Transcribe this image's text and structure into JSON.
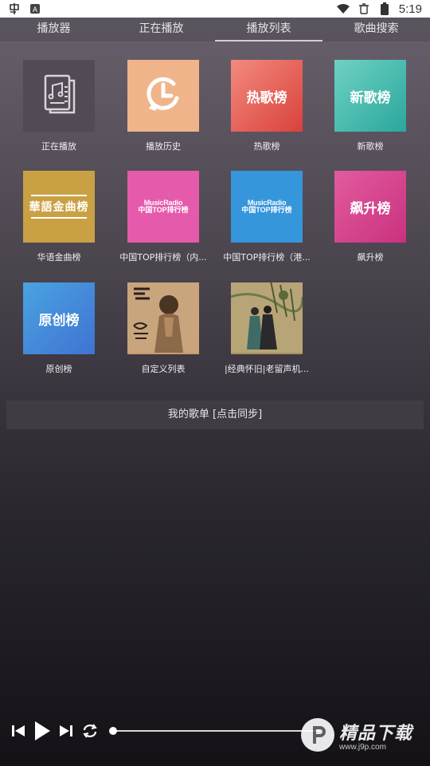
{
  "status_bar": {
    "time": "5:19",
    "icons": [
      "app-icon",
      "a-icon",
      "wifi-icon",
      "trash-icon",
      "battery-icon"
    ]
  },
  "tabs": [
    {
      "label": "播放器",
      "active": false
    },
    {
      "label": "正在播放",
      "active": false
    },
    {
      "label": "播放列表",
      "active": true
    },
    {
      "label": "歌曲搜索",
      "active": false
    }
  ],
  "playlists": [
    {
      "label": "正在播放",
      "tile_icon": "music-document-icon",
      "tile_text": ""
    },
    {
      "label": "播放历史",
      "tile_icon": "history-clock-icon",
      "tile_text": ""
    },
    {
      "label": "热歌榜",
      "tile_icon": "",
      "tile_text": "热歌榜"
    },
    {
      "label": "新歌榜",
      "tile_icon": "",
      "tile_text": "新歌榜"
    },
    {
      "label": "华语金曲榜",
      "tile_icon": "",
      "tile_text": "華語金曲榜"
    },
    {
      "label": "中国TOP排行榜（内...",
      "tile_icon": "",
      "tile_text": "MusicRadio",
      "tile_sub": "中国TOP排行榜"
    },
    {
      "label": "中国TOP排行榜（港...",
      "tile_icon": "",
      "tile_text": "MusicRadio",
      "tile_sub": "中国TOP排行榜"
    },
    {
      "label": "飙升榜",
      "tile_icon": "",
      "tile_text": "飙升榜"
    },
    {
      "label": "原创榜",
      "tile_icon": "",
      "tile_text": "原创榜"
    },
    {
      "label": "自定义列表",
      "tile_icon": "album-cover-icon",
      "tile_text": ""
    },
    {
      "label": "|经典怀旧|老留声机...",
      "tile_icon": "album-cover-icon",
      "tile_text": ""
    }
  ],
  "my_playlist": {
    "label": "我的歌单 [点击同步]"
  },
  "player": {
    "progress": 0.0,
    "controls": [
      "previous-icon",
      "play-icon",
      "next-icon",
      "repeat-icon"
    ]
  },
  "watermark": {
    "main": "精品下载",
    "url": "www.j9p.com"
  }
}
